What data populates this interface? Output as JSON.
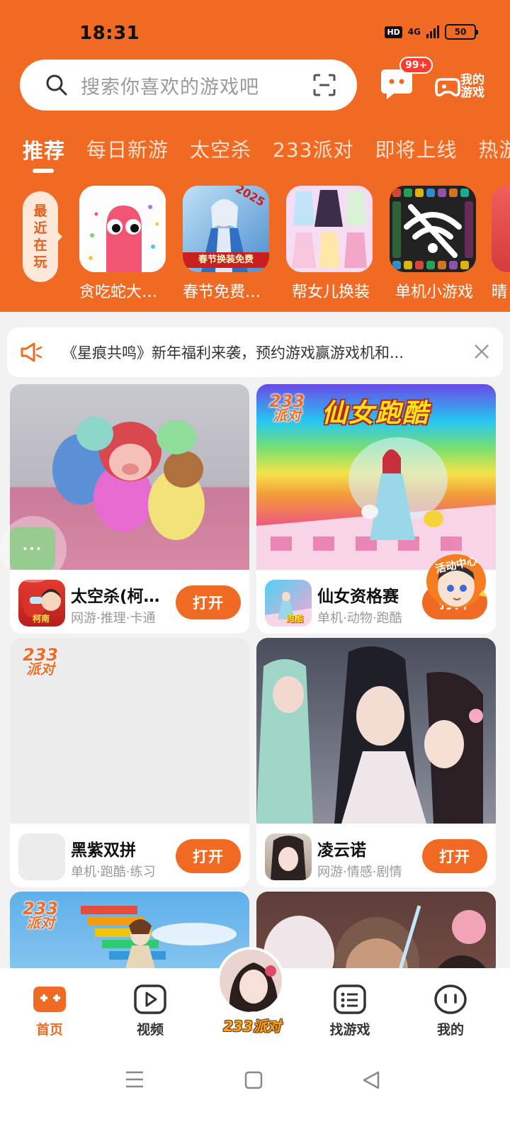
{
  "status_bar": {
    "time": "18:31",
    "hd": "HD",
    "network": "4G",
    "battery": "50"
  },
  "header": {
    "search_placeholder": "搜索你喜欢的游戏吧",
    "message_badge": "99+",
    "my_games_label": "我的游戏"
  },
  "tabs": [
    "推荐",
    "每日新游",
    "太空杀",
    "233派对",
    "即将上线",
    "热游"
  ],
  "recent": {
    "label_chars": [
      "最",
      "近",
      "在",
      "玩"
    ],
    "games": [
      {
        "name": "贪吃蛇大作战"
      },
      {
        "name": "春节免费换装"
      },
      {
        "name": "帮女儿换装"
      },
      {
        "name": "单机小游戏"
      },
      {
        "name": "晴"
      }
    ]
  },
  "notice": {
    "text": "《星痕共鸣》新年福利来袭，预约游戏赢游戏机和..."
  },
  "cards": [
    {
      "title": "太空杀(柯南联动)",
      "tags": "网游·推理·卡通",
      "button": "打开",
      "icon_text": "柯南"
    },
    {
      "title": "仙女资格赛",
      "tags": "单机·动物·跑酷",
      "button": "打开",
      "banner_title": "仙女跑酷",
      "icon_text": "跑酷"
    },
    {
      "title": "黑紫双拼",
      "tags": "单机·跑酷·练习",
      "button": "打开"
    },
    {
      "title": "凌云诺",
      "tags": "网游·情感·剧情",
      "button": "打开"
    },
    {
      "title": "",
      "tags": "",
      "button": ""
    },
    {
      "title": "",
      "tags": "",
      "button": ""
    }
  ],
  "badge_233": {
    "line1": "233",
    "line2": "派对"
  },
  "recent_thumb_texts": {
    "spring_banner": "春节换装免费",
    "year": "2025"
  },
  "floating": {
    "activity_label": "活动中心"
  },
  "bottom_nav": {
    "items": [
      {
        "label": "首页"
      },
      {
        "label": "视频"
      },
      {
        "label": "找游戏"
      },
      {
        "label": "我的"
      }
    ],
    "center_label": "233派对"
  },
  "colors": {
    "brand_orange": "#f06a23",
    "badge_red": "#ff3a2f",
    "background": "#f2f2f2"
  }
}
